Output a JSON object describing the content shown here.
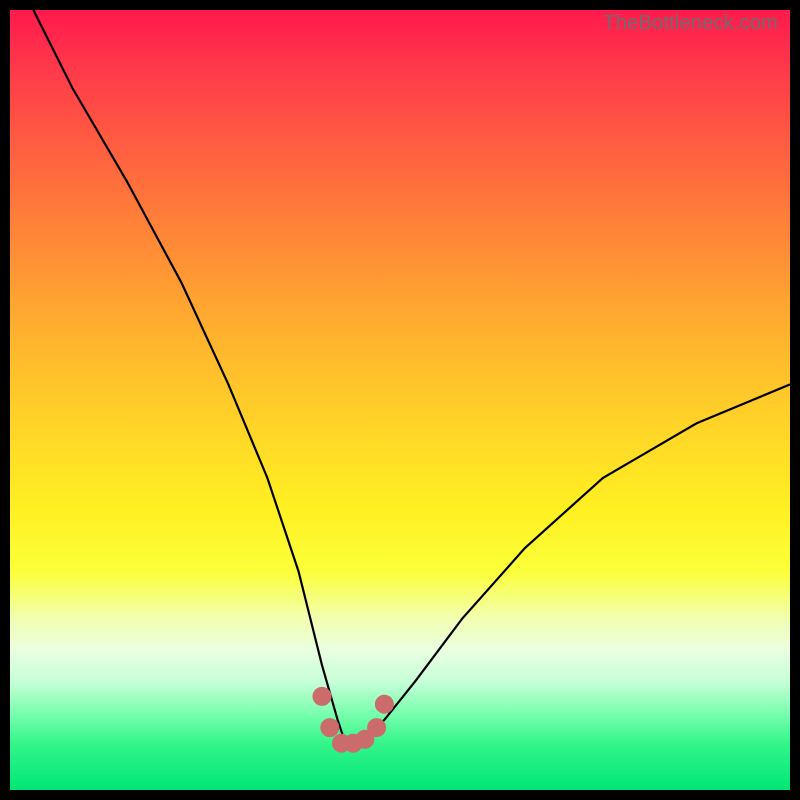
{
  "watermark": "TheBottleneck.com",
  "colors": {
    "frame": "#000000",
    "curve_stroke": "#000000",
    "marker_fill": "#cc6b6b",
    "marker_stroke": "#cc6b6b"
  },
  "chart_data": {
    "type": "line",
    "title": "",
    "xlabel": "",
    "ylabel": "",
    "xlim": [
      0,
      100
    ],
    "ylim": [
      0,
      100
    ],
    "grid": false,
    "legend": false,
    "background": "vertical-gradient red→orange→yellow→green (top=high bottleneck, bottom=low)",
    "series": [
      {
        "name": "bottleneck-curve",
        "note": "V-shaped curve; y ≈ bottleneck %, minimum near x≈43 at y≈6; right branch plateaus ~52%",
        "x": [
          3,
          8,
          15,
          22,
          28,
          33,
          37,
          40,
          42,
          43,
          44,
          46,
          48,
          52,
          58,
          66,
          76,
          88,
          100
        ],
        "y": [
          100,
          90,
          78,
          65,
          52,
          40,
          28,
          16,
          9,
          6,
          6,
          7,
          9,
          14,
          22,
          31,
          40,
          47,
          52
        ]
      },
      {
        "name": "optimal-range-markers",
        "type": "scatter",
        "note": "pink dots along trough indicating low-bottleneck region",
        "x": [
          40,
          41,
          42.5,
          44,
          45.5,
          47,
          48
        ],
        "y": [
          12,
          8,
          6,
          6,
          6.5,
          8,
          11
        ]
      }
    ]
  }
}
